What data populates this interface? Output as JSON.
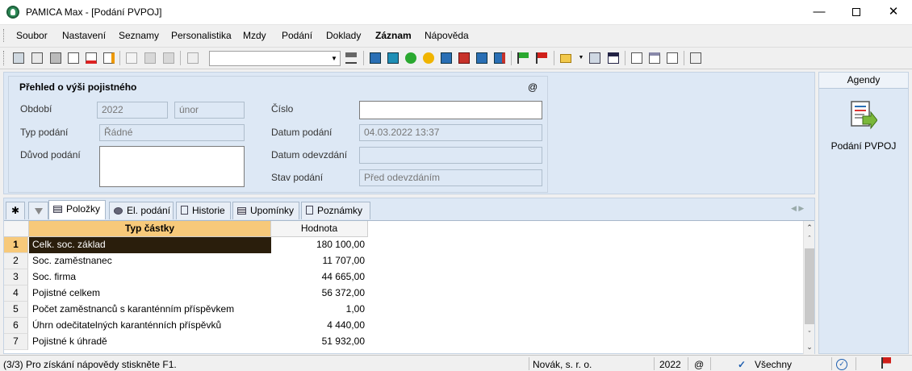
{
  "window": {
    "title": "PAMICA Max - [Podání PVPOJ]"
  },
  "menu": [
    "Soubor",
    "Nastavení",
    "Seznamy",
    "Personalistika",
    "Mzdy",
    "Podání",
    "Doklady",
    "Záznam",
    "Nápověda"
  ],
  "form": {
    "section_title": "Přehled o výši pojistného",
    "at_symbol": "@",
    "obdobi_label": "Období",
    "obdobi_year": "2022",
    "obdobi_month": "únor",
    "cislo_label": "Číslo",
    "cislo_value": "",
    "typ_label": "Typ podání",
    "typ_value": "Řádné",
    "datum_label": "Datum podání",
    "datum_value": "04.03.2022 13:37",
    "duvod_label": "Důvod podání",
    "datum_odevzdani_label": "Datum odevzdání",
    "datum_odevzdani_value": "",
    "stav_label": "Stav podání",
    "stav_value": "Před odevzdáním"
  },
  "agendy": {
    "header": "Agendy",
    "item_label": "Podání PVPOJ"
  },
  "tabs": {
    "star": "✱",
    "items": [
      "Položky",
      "El. podání",
      "Historie",
      "Upomínky",
      "Poznámky"
    ]
  },
  "grid": {
    "columns": [
      "Typ částky",
      "Hodnota"
    ],
    "rows": [
      {
        "num": "1",
        "typ": "Celk. soc. základ",
        "hodnota": "180 100,00"
      },
      {
        "num": "2",
        "typ": "Soc. zaměstnanec",
        "hodnota": "11 707,00"
      },
      {
        "num": "3",
        "typ": "Soc. firma",
        "hodnota": "44 665,00"
      },
      {
        "num": "4",
        "typ": "Pojistné celkem",
        "hodnota": "56 372,00"
      },
      {
        "num": "5",
        "typ": "Počet zaměstnanců s karanténním příspěvkem",
        "hodnota": "1,00"
      },
      {
        "num": "6",
        "typ": "Úhrn odečitatelných karanténních příspěvků",
        "hodnota": "4 440,00"
      },
      {
        "num": "7",
        "typ": "Pojistné k úhradě",
        "hodnota": "51 932,00"
      }
    ]
  },
  "status": {
    "help": "(3/3) Pro získání nápovědy stiskněte F1.",
    "company": "Novák, s. r. o.",
    "year": "2022",
    "at": "@",
    "filter": "Všechny"
  },
  "colors": {
    "selection_header": "#f7c97a",
    "selection_cell": "#2a1e0c",
    "panel": "#dde8f5"
  }
}
